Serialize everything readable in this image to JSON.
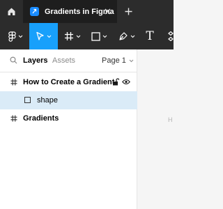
{
  "app": {
    "tab_title": "Gradients in Figma",
    "tab_icon": "figma-file-icon",
    "colors": {
      "chrome": "#2c2c2c",
      "active_tab": "#1e1e1e",
      "accent": "#18a0fb",
      "selected_row": "#daebf7"
    }
  },
  "toolbar": {
    "tools": [
      {
        "name": "main-menu",
        "icon": "figma-logo-icon"
      },
      {
        "name": "move",
        "icon": "move-cursor-icon",
        "active": true
      },
      {
        "name": "frame",
        "icon": "hash-frame-icon"
      },
      {
        "name": "shape",
        "icon": "rectangle-icon"
      },
      {
        "name": "pen",
        "icon": "pen-icon"
      },
      {
        "name": "text",
        "icon": "text-icon",
        "label": "T"
      }
    ]
  },
  "panel": {
    "tabs": {
      "layers": "Layers",
      "assets": "Assets"
    },
    "page_selector": "Page 1",
    "layers": [
      {
        "label": "How to Create a Gradient",
        "icon": "hash-frame-icon",
        "level": 0
      },
      {
        "label": "shape",
        "icon": "rectangle-icon",
        "level": 1,
        "selected": true
      },
      {
        "label": "Gradients",
        "icon": "hash-frame-icon",
        "level": 0
      }
    ]
  },
  "canvas": {
    "hint": "H"
  }
}
